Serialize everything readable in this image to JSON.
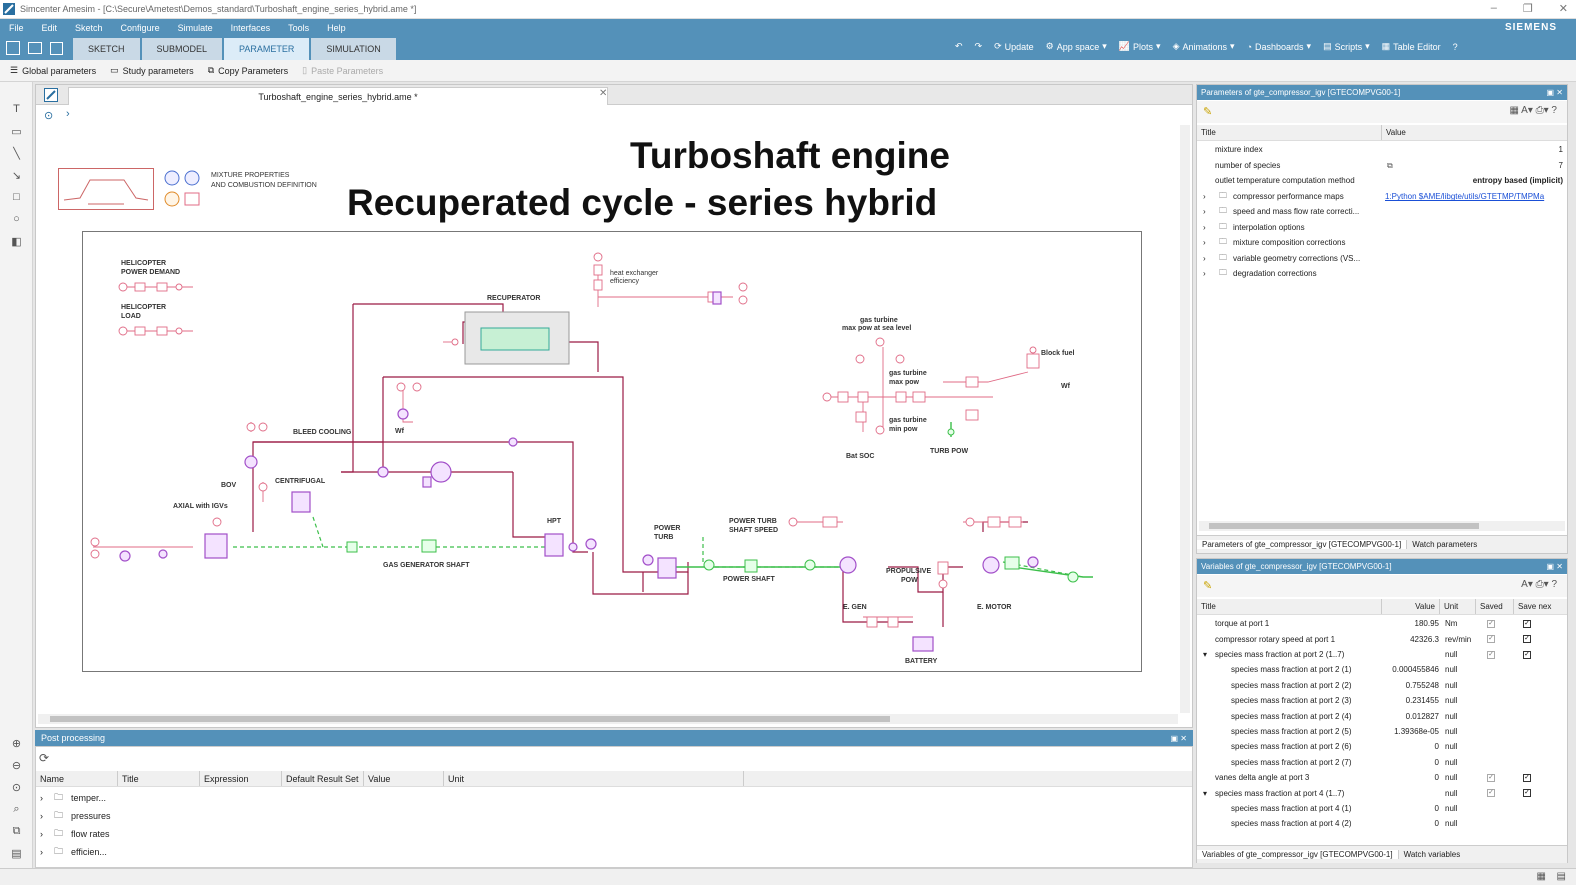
{
  "window": {
    "title": "Simcenter Amesim - [C:\\Secure\\Ametest\\Demos_standard\\Turboshaft_engine_series_hybrid.ame *]",
    "brand": "SIEMENS",
    "menu": [
      "File",
      "Edit",
      "Sketch",
      "Configure",
      "Simulate",
      "Interfaces",
      "Tools",
      "Help"
    ]
  },
  "toolbar": {
    "modes": [
      "SKETCH",
      "SUBMODEL",
      "PARAMETER",
      "SIMULATION"
    ],
    "active_mode": "PARAMETER",
    "right_buttons": [
      "Update",
      "App space",
      "Plots",
      "Animations",
      "Dashboards",
      "Scripts",
      "Table Editor"
    ]
  },
  "ribbon": {
    "global_params": "Global parameters",
    "study_params": "Study parameters",
    "copy_params": "Copy Parameters",
    "paste_params": "Paste Parameters"
  },
  "document": {
    "tab_title": "Turboshaft_engine_series_hybrid.ame *",
    "title_line1": "Turboshaft engine",
    "title_line2": "Recuperated cycle - series hybrid",
    "mixture_label1": "MIXTURE PROPERTIES",
    "mixture_label2": "AND COMBUSTION DEFINITION",
    "labels": {
      "heli_power1": "HELICOPTER",
      "heli_power2": "POWER DEMAND",
      "heli_load1": "HELICOPTER",
      "heli_load2": "LOAD",
      "recuperator": "RECUPERATOR",
      "hx_eff1": "heat exchanger",
      "hx_eff2": "efficiency",
      "bleed": "BLEED COOLING",
      "wf1": "Wf",
      "bov": "BOV",
      "centrifugal": "CENTRIFUGAL",
      "axial": "AXIAL with IGVs",
      "gg_shaft": "GAS GENERATOR SHAFT",
      "hpt": "HPT",
      "power_turb1": "POWER",
      "power_turb2": "TURB",
      "pt_speed1": "POWER TURB",
      "pt_speed2": "SHAFT SPEED",
      "power_shaft": "POWER SHAFT",
      "prop_pow1": "PROPULSIVE",
      "prop_pow2": "POW",
      "egen": "E. GEN",
      "emotor": "E. MOTOR",
      "battery": "BATTERY",
      "gt_max1": "gas turbine",
      "gt_max2": "max pow at sea level",
      "gt_maxpow1": "gas turbine",
      "gt_maxpow2": "max pow",
      "gt_minpow1": "gas turbine",
      "gt_minpow2": "min pow",
      "block_fuel": "Block fuel",
      "wf2": "Wf",
      "bat_soc": "Bat SOC",
      "turb_pow": "TURB POW"
    }
  },
  "post": {
    "header": "Post processing",
    "columns": [
      "Name",
      "Title",
      "Expression",
      "Default Result Set",
      "Value",
      "Unit"
    ],
    "rows": [
      "temper...",
      "pressures",
      "flow rates",
      "efficien..."
    ]
  },
  "params_panel": {
    "header": "Parameters of gte_compressor_igv [GTECOMPVG00-1]",
    "col_title": "Title",
    "col_value": "Value",
    "rows": [
      {
        "title": "mixture index",
        "value": "1"
      },
      {
        "title": "number of species",
        "value": "7"
      },
      {
        "title": "outlet temperature computation method",
        "value": "entropy based (implicit)"
      },
      {
        "title": "compressor performance maps",
        "value": "1:Python $AME/libgte/utils/GTETMP/TMPMa"
      },
      {
        "title": "speed and mass flow rate correcti...",
        "value": ""
      },
      {
        "title": "interpolation options",
        "value": ""
      },
      {
        "title": "mixture composition corrections",
        "value": ""
      },
      {
        "title": "variable geometry corrections (VS...",
        "value": ""
      },
      {
        "title": "degradation corrections",
        "value": ""
      }
    ],
    "bottom_tab1": "Parameters of gte_compressor_igv [GTECOMPVG00-1]",
    "bottom_tab2": "Watch parameters"
  },
  "vars_panel": {
    "header": "Variables of gte_compressor_igv [GTECOMPVG00-1]",
    "columns": [
      "Title",
      "Value",
      "Unit",
      "Saved",
      "Save nex"
    ],
    "rows": [
      {
        "title": "torque at port 1",
        "value": "180.95",
        "unit": "Nm",
        "indent": 1,
        "saved": true,
        "next": true
      },
      {
        "title": "compressor rotary speed at port 1",
        "value": "42326.3",
        "unit": "rev/min",
        "indent": 1,
        "saved": true,
        "next": true
      },
      {
        "title": "species mass fraction at port 2 (1..7)",
        "value": "",
        "unit": "null",
        "indent": 0,
        "saved": true,
        "next": true
      },
      {
        "title": "species mass fraction at port 2 (1)",
        "value": "0.000455846",
        "unit": "null",
        "indent": 2
      },
      {
        "title": "species mass fraction at port 2 (2)",
        "value": "0.755248",
        "unit": "null",
        "indent": 2
      },
      {
        "title": "species mass fraction at port 2 (3)",
        "value": "0.231455",
        "unit": "null",
        "indent": 2
      },
      {
        "title": "species mass fraction at port 2 (4)",
        "value": "0.012827",
        "unit": "null",
        "indent": 2
      },
      {
        "title": "species mass fraction at port 2 (5)",
        "value": "1.39368e-05",
        "unit": "null",
        "indent": 2
      },
      {
        "title": "species mass fraction at port 2 (6)",
        "value": "0",
        "unit": "null",
        "indent": 2
      },
      {
        "title": "species mass fraction at port 2 (7)",
        "value": "0",
        "unit": "null",
        "indent": 2
      },
      {
        "title": "vanes delta angle at port 3",
        "value": "0",
        "unit": "null",
        "indent": 1,
        "saved": true,
        "next": true
      },
      {
        "title": "species mass fraction at port 4 (1..7)",
        "value": "",
        "unit": "null",
        "indent": 0,
        "saved": true,
        "next": true
      },
      {
        "title": "species mass fraction at port 4 (1)",
        "value": "0",
        "unit": "null",
        "indent": 2
      },
      {
        "title": "species mass fraction at port 4 (2)",
        "value": "0",
        "unit": "null",
        "indent": 2
      }
    ],
    "bottom_tab1": "Variables of gte_compressor_igv [GTECOMPVG00-1]",
    "bottom_tab2": "Watch variables"
  },
  "colors": {
    "accent": "#5491b9",
    "pink": "#e06b86",
    "purple": "#a24fc9",
    "green": "#3cbf4a",
    "wire": "#9b1b45"
  }
}
